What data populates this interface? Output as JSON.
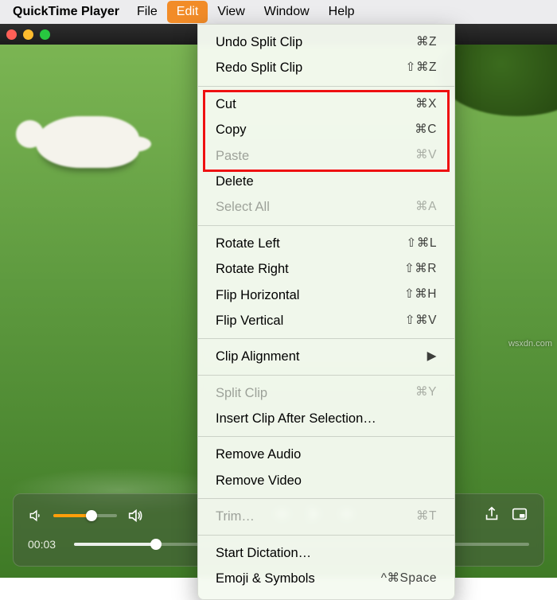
{
  "app_name": "QuickTime Player",
  "menubar": {
    "items": [
      "File",
      "Edit",
      "View",
      "Window",
      "Help"
    ],
    "open_index": 1
  },
  "dropdown": {
    "groups": [
      [
        {
          "label": "Undo Split Clip",
          "shortcut": "⌘Z",
          "enabled": true
        },
        {
          "label": "Redo Split Clip",
          "shortcut": "⇧⌘Z",
          "enabled": true
        }
      ],
      [
        {
          "label": "Cut",
          "shortcut": "⌘X",
          "enabled": true,
          "in_highlight": true
        },
        {
          "label": "Copy",
          "shortcut": "⌘C",
          "enabled": true,
          "in_highlight": true
        },
        {
          "label": "Paste",
          "shortcut": "⌘V",
          "enabled": false,
          "in_highlight": true
        },
        {
          "label": "Delete",
          "shortcut": "",
          "enabled": true
        },
        {
          "label": "Select All",
          "shortcut": "⌘A",
          "enabled": false
        }
      ],
      [
        {
          "label": "Rotate Left",
          "shortcut": "⇧⌘L",
          "enabled": true
        },
        {
          "label": "Rotate Right",
          "shortcut": "⇧⌘R",
          "enabled": true
        },
        {
          "label": "Flip Horizontal",
          "shortcut": "⇧⌘H",
          "enabled": true
        },
        {
          "label": "Flip Vertical",
          "shortcut": "⇧⌘V",
          "enabled": true
        }
      ],
      [
        {
          "label": "Clip Alignment",
          "shortcut": "▶",
          "enabled": true,
          "submenu": true
        }
      ],
      [
        {
          "label": "Split Clip",
          "shortcut": "⌘Y",
          "enabled": false
        },
        {
          "label": "Insert Clip After Selection…",
          "shortcut": "",
          "enabled": true
        }
      ],
      [
        {
          "label": "Remove Audio",
          "shortcut": "",
          "enabled": true
        },
        {
          "label": "Remove Video",
          "shortcut": "",
          "enabled": true
        }
      ],
      [
        {
          "label": "Trim…",
          "shortcut": "⌘T",
          "enabled": false
        }
      ],
      [
        {
          "label": "Start Dictation…",
          "shortcut": "",
          "enabled": true
        },
        {
          "label": "Emoji & Symbols",
          "shortcut": "^⌘Space",
          "enabled": true
        }
      ]
    ]
  },
  "player": {
    "time_current": "00:03",
    "volume_fill_pct": 60,
    "timeline_fill_pct": 18
  },
  "watermark": "wsxdn.com"
}
